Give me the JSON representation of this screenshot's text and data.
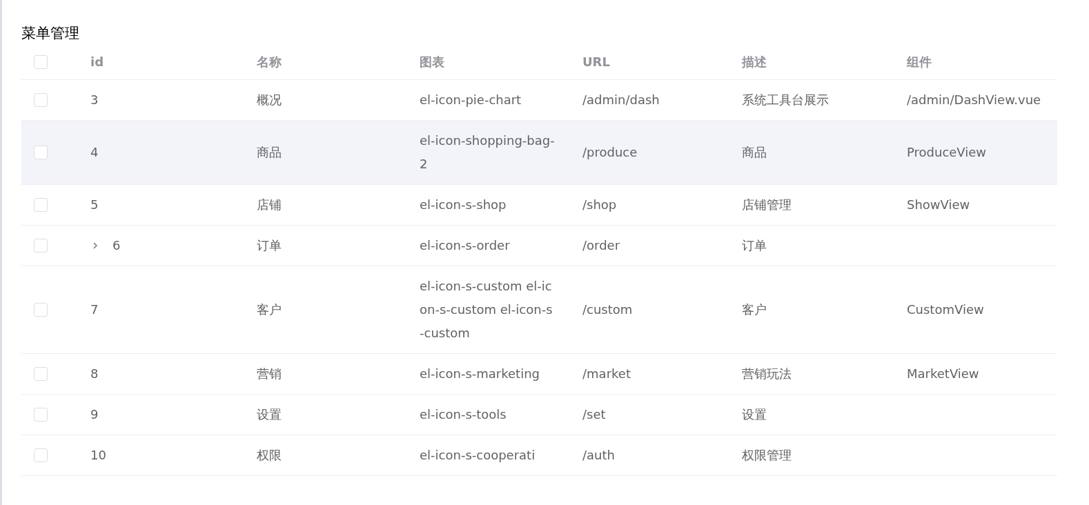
{
  "title": "菜单管理",
  "columns": [
    "id",
    "名称",
    "图表",
    "URL",
    "描述",
    "组件"
  ],
  "header_checkbox": {
    "checked": false
  },
  "rows": [
    {
      "checked": false,
      "highlighted": false,
      "cells": [
        "3",
        "概况",
        "el-icon-pie-chart",
        "/admin/dash",
        "系统工具台展示",
        "/admin/DashView.vue"
      ]
    },
    {
      "checked": false,
      "highlighted": true,
      "cells": [
        "4",
        "商品",
        "el-icon-shopping-bag-2",
        "/produce",
        "商品",
        "ProduceView"
      ]
    },
    {
      "checked": false,
      "highlighted": false,
      "cells": [
        "5",
        "店铺",
        "el-icon-s-shop",
        "/shop",
        "店铺管理",
        "ShowView"
      ]
    },
    {
      "checked": false,
      "highlighted": false,
      "expanded": false,
      "cells": [
        "6",
        "订单",
        "el-icon-s-order",
        "/order",
        "订单"
      ]
    },
    {
      "checked": false,
      "highlighted": false,
      "cells": [
        "7",
        "客户",
        "el-icon-s-custom el-icon-s-custom el-icon-s-custom",
        "/custom",
        "客户",
        "CustomView"
      ]
    },
    {
      "checked": false,
      "highlighted": false,
      "cells": [
        "8",
        "营销",
        "el-icon-s-marketing",
        "/market",
        "营销玩法",
        "MarketView"
      ]
    },
    {
      "checked": false,
      "highlighted": false,
      "cells": [
        "9",
        "设置",
        "el-icon-s-tools",
        "/set",
        "设置"
      ]
    },
    {
      "checked": false,
      "highlighted": false,
      "cells": [
        "10",
        "权限",
        "el-icon-s-cooperati",
        "/auth",
        "权限管理"
      ]
    }
  ]
}
